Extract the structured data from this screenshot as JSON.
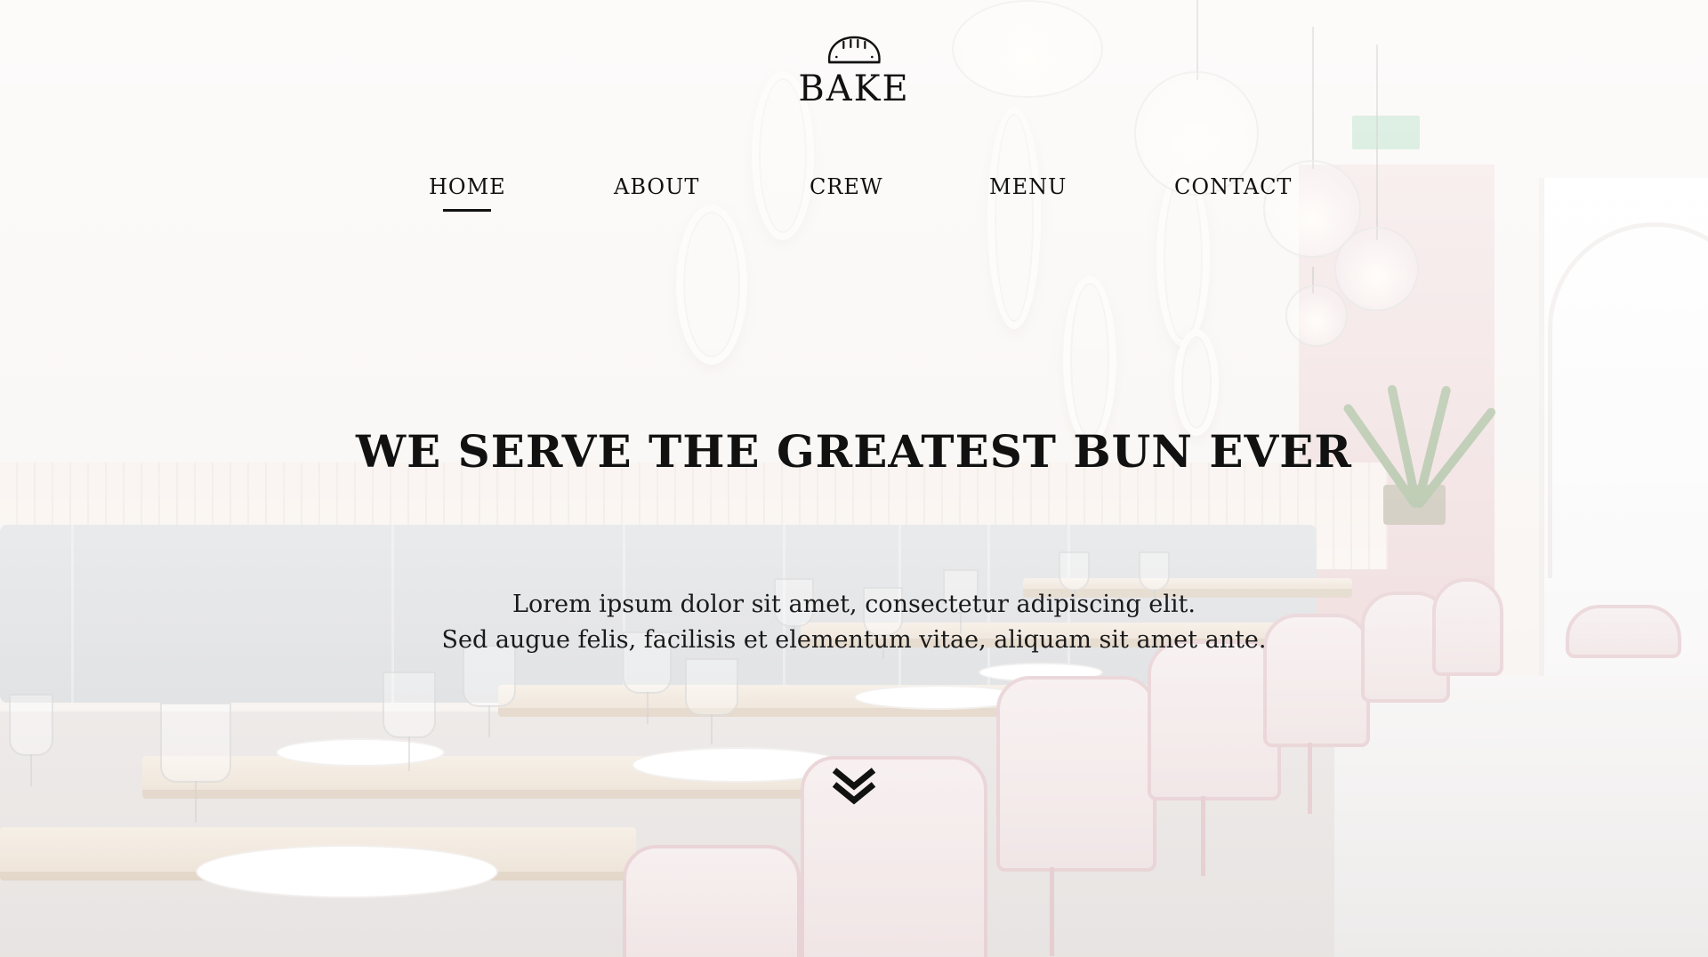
{
  "brand": {
    "name": "BAKE",
    "icon": "bread-loaf-icon"
  },
  "nav": {
    "items": [
      {
        "label": "HOME",
        "active": true
      },
      {
        "label": "ABOUT",
        "active": false
      },
      {
        "label": "CREW",
        "active": false
      },
      {
        "label": "MENU",
        "active": false
      },
      {
        "label": "CONTACT",
        "active": false
      }
    ]
  },
  "hero": {
    "headline": "WE SERVE THE GREATEST BUN EVER",
    "lines": [
      "Lorem ipsum dolor sit amet, consectetur adipiscing elit.",
      "Sed augue felis, facilisis et elementum vitae, aliquam sit amet ante."
    ],
    "scroll_icon": "double-chevron-down-icon"
  },
  "colors": {
    "text": "#111111",
    "accent_pink": "#d8b1b6"
  }
}
